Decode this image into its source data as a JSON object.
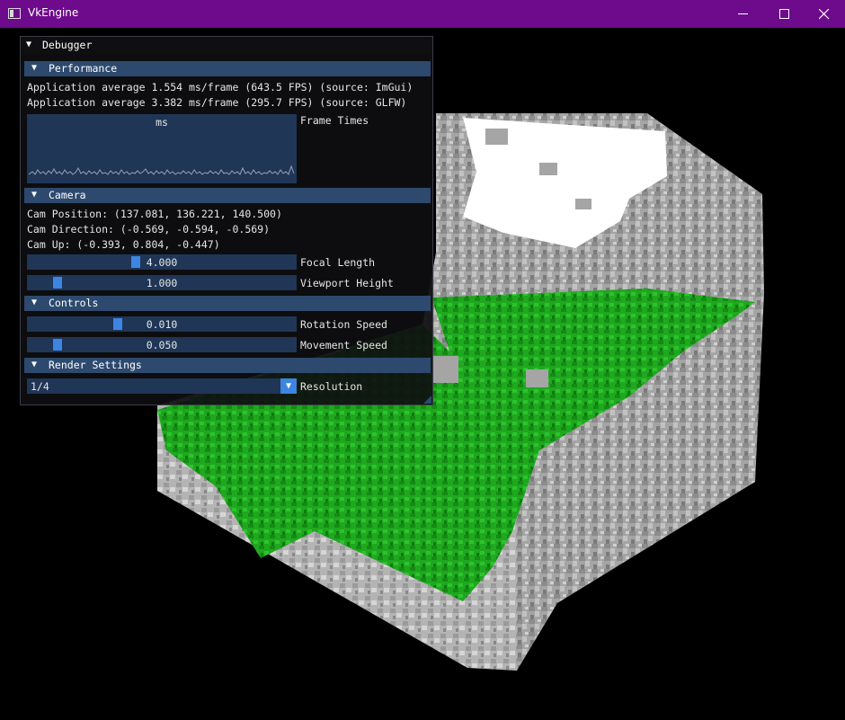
{
  "window": {
    "title": "VkEngine"
  },
  "colors": {
    "titlebar": "#6e0a8c",
    "section_header": "#2d4a6e",
    "frame_bg": "#1f3657",
    "accent": "#3d85e0",
    "grass": "#1fb01f",
    "snow": "#ffffff",
    "stone": "#a8a8a8"
  },
  "icons": {
    "app": "app-window-icon",
    "minimize": "minimize-icon",
    "maximize": "maximize-icon",
    "close": "close-icon",
    "collapse": "triangle-down-icon"
  },
  "debugger": {
    "title": "Debugger",
    "performance": {
      "header": "Performance",
      "line1": "Application average 1.554 ms/frame (643.5 FPS) (source: ImGui)",
      "line2": "Application average 3.382 ms/frame (295.7 FPS) (source: GLFW)",
      "plot_title": "ms",
      "plot_label": "Frame Times"
    },
    "camera": {
      "header": "Camera",
      "position": "Cam Position: (137.081, 136.221, 140.500)",
      "direction": "Cam Direction: (-0.569, -0.594, -0.569)",
      "up": "Cam Up: (-0.393, 0.804, -0.447)",
      "focal_length": {
        "value": "4.000",
        "label": "Focal Length",
        "fraction": 0.4
      },
      "viewport_height": {
        "value": "1.000",
        "label": "Viewport Height",
        "fraction": 0.1
      }
    },
    "controls": {
      "header": "Controls",
      "rotation_speed": {
        "value": "0.010",
        "label": "Rotation Speed",
        "fraction": 0.33
      },
      "movement_speed": {
        "value": "0.050",
        "label": "Movement Speed",
        "fraction": 0.1
      }
    },
    "render_settings": {
      "header": "Render Settings",
      "resolution": {
        "value": "1/4",
        "label": "Resolution"
      }
    }
  }
}
